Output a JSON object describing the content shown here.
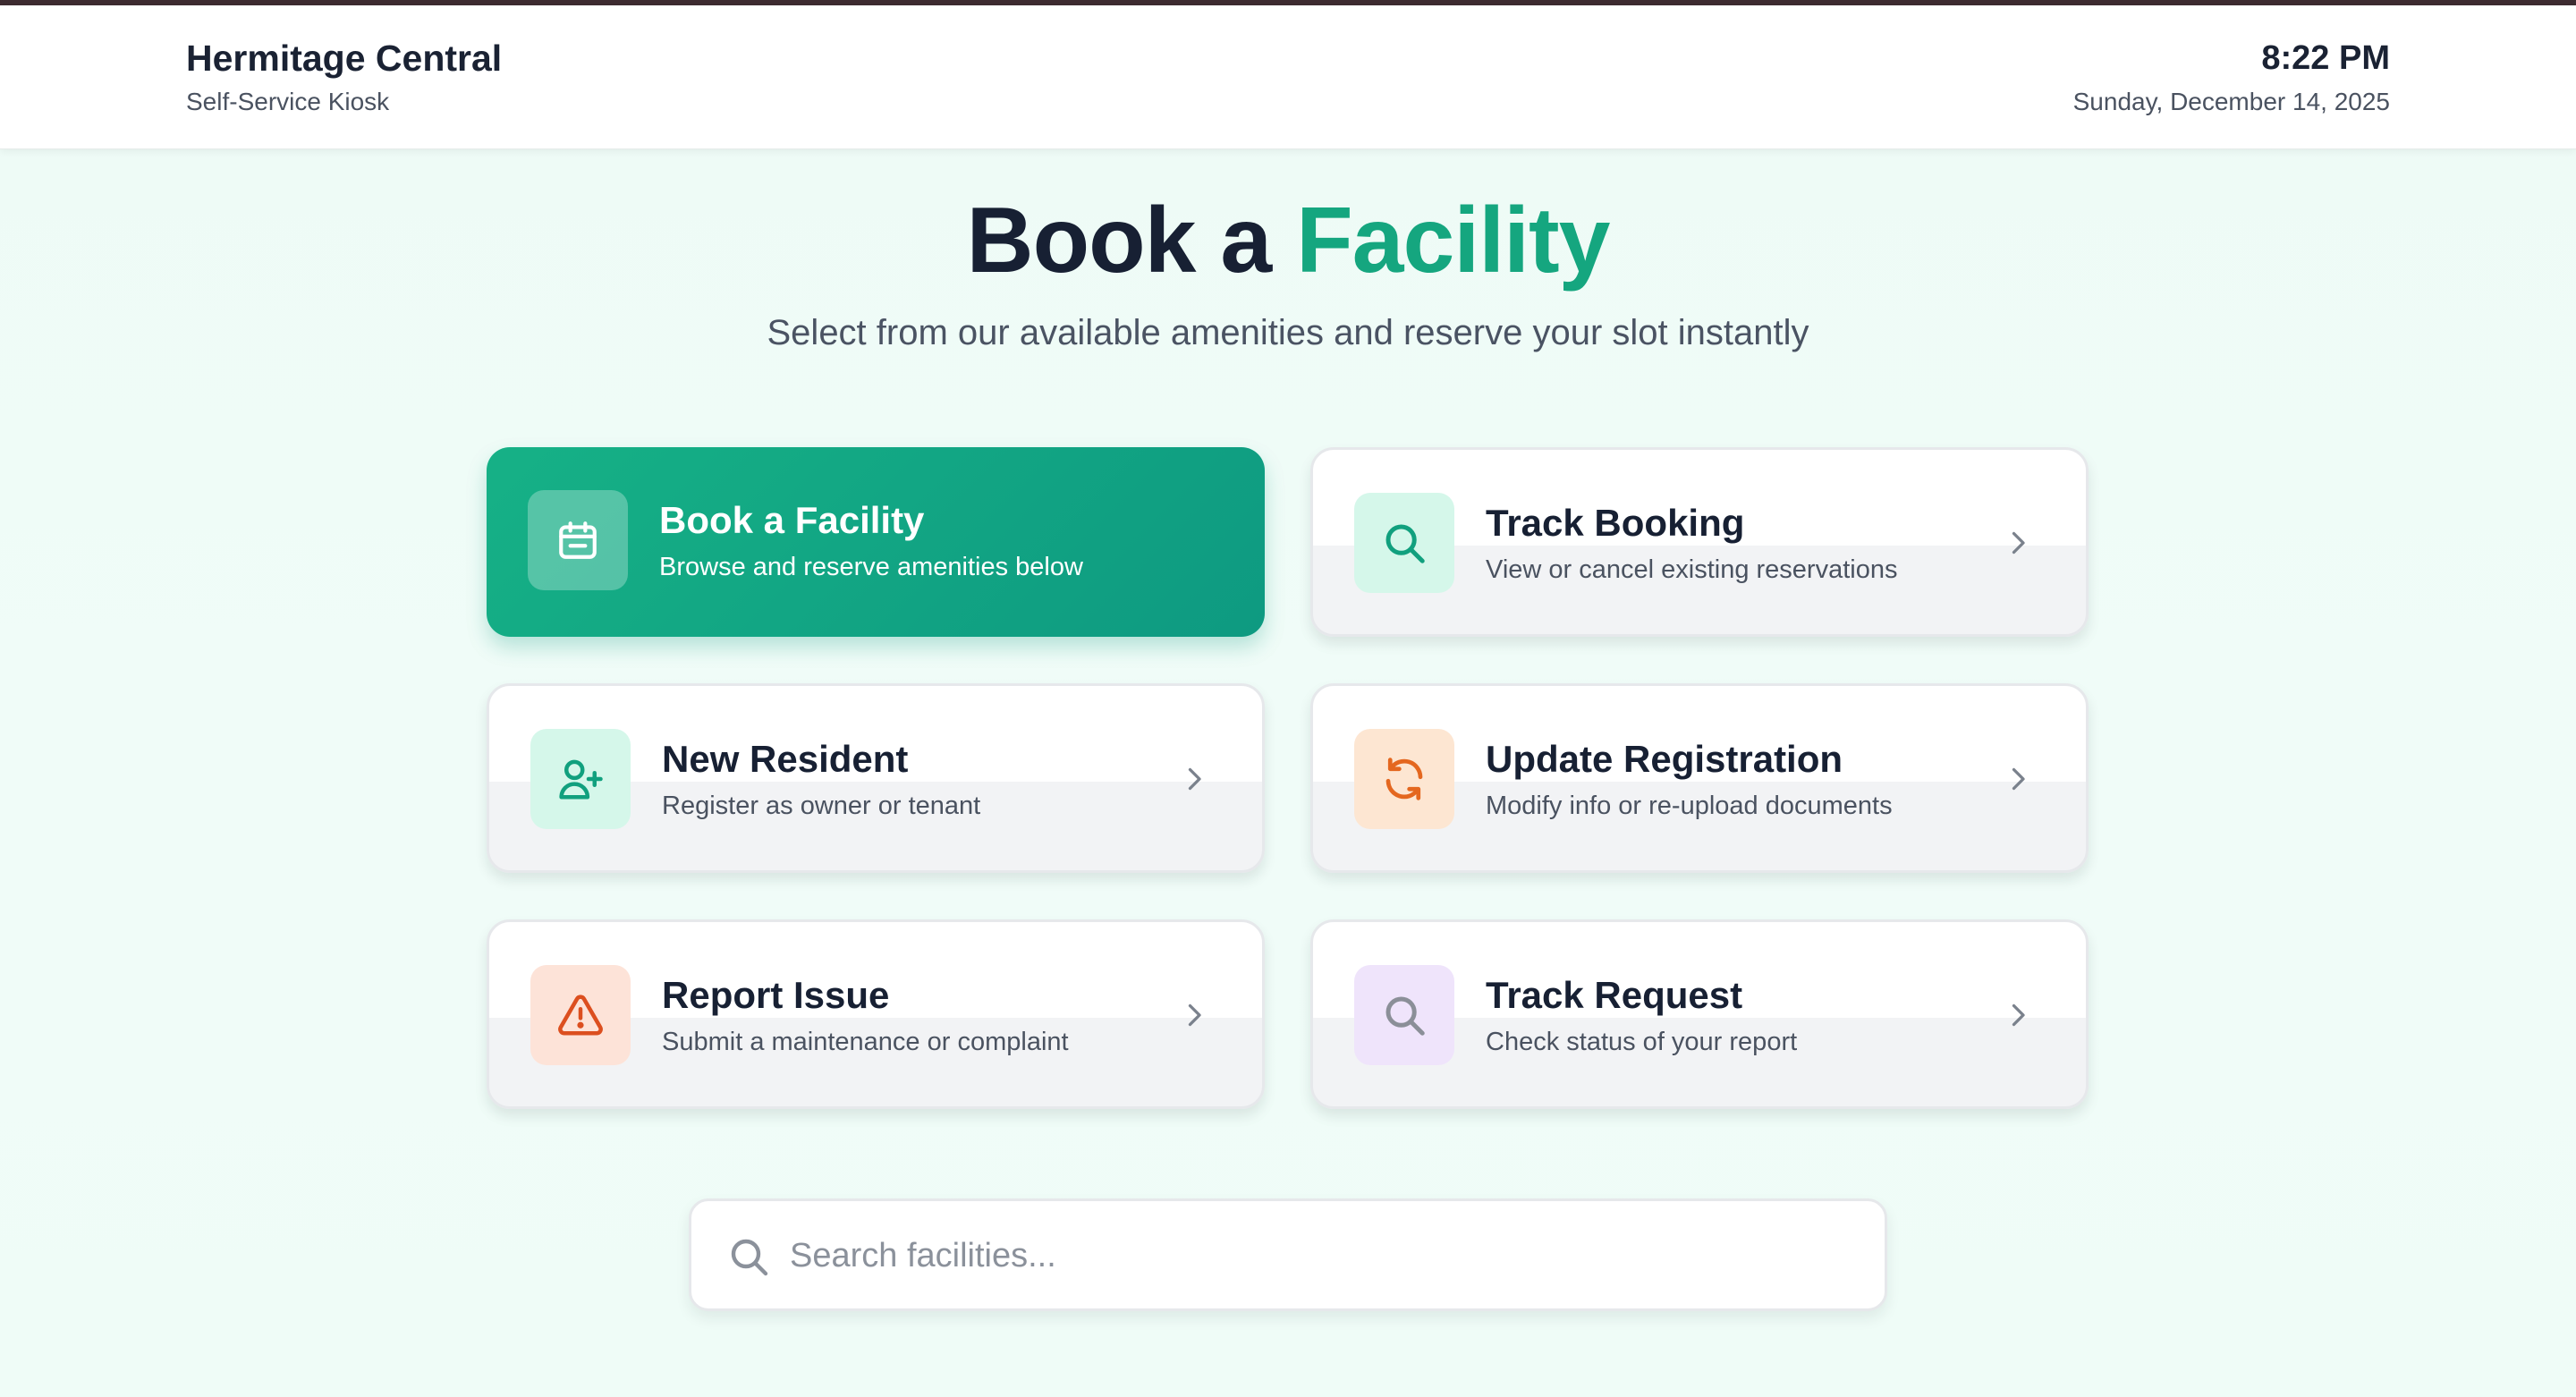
{
  "header": {
    "title": "Hermitage Central",
    "subtitle": "Self-Service Kiosk",
    "time": "8:22 PM",
    "date": "Sunday, December 14, 2025"
  },
  "hero": {
    "title_part1": "Book a ",
    "title_part2": "Facility",
    "subtitle": "Select from our available amenities and reserve your slot instantly"
  },
  "cards": [
    {
      "title": "Book a Facility",
      "desc": "Browse and reserve amenities below",
      "icon": "calendar-icon",
      "active": true
    },
    {
      "title": "Track Booking",
      "desc": "View or cancel existing reservations",
      "icon": "search-icon"
    },
    {
      "title": "New Resident",
      "desc": "Register as owner or tenant",
      "icon": "user-plus-icon"
    },
    {
      "title": "Update Registration",
      "desc": "Modify info or re-upload documents",
      "icon": "refresh-icon"
    },
    {
      "title": "Report Issue",
      "desc": "Submit a maintenance or complaint",
      "icon": "warning-icon"
    },
    {
      "title": "Track Request",
      "desc": "Check status of your report",
      "icon": "search-icon"
    }
  ],
  "search": {
    "placeholder": "Search facilities...",
    "value": ""
  },
  "colors": {
    "accent": "#15a67f",
    "primary_card": "#12a784",
    "topline": "#3d2b30"
  }
}
